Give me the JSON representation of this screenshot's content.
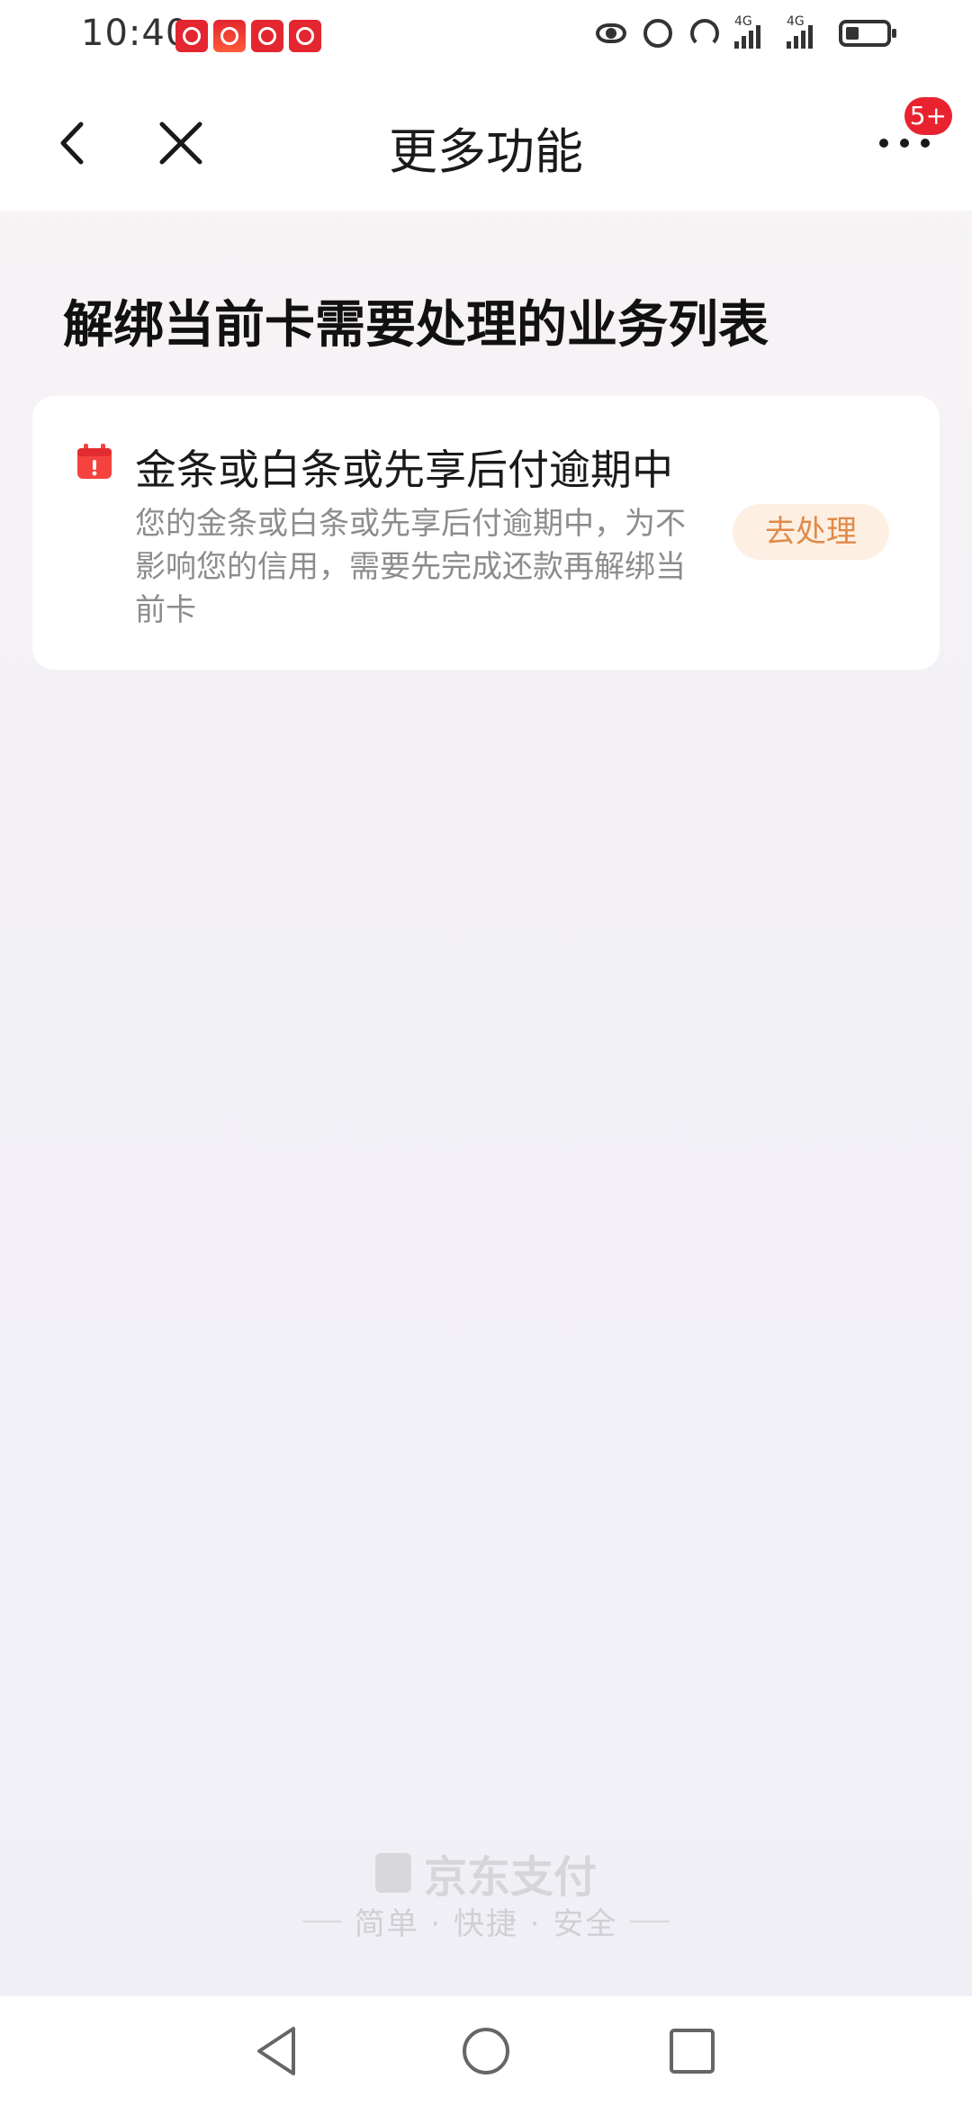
{
  "status_bar": {
    "time": "10:40",
    "signal_label_1": "4G",
    "signal_label_2": "4G"
  },
  "nav": {
    "title": "更多功能",
    "badge": "5+"
  },
  "section": {
    "heading": "解绑当前卡需要处理的业务列表"
  },
  "items": [
    {
      "title": "金条或白条或先享后付逾期中",
      "description": "您的金条或白条或先享后付逾期中，为不影响您的信用，需要先完成还款再解绑当前卡",
      "action_label": "去处理",
      "icon": "calendar-alert-icon"
    }
  ],
  "footer": {
    "brand": "京东支付",
    "slogan": "简单 · 快捷 · 安全"
  },
  "colors": {
    "accent_red": "#e8232f",
    "action_text": "#e08a4a",
    "action_bg": "#fdf0e3"
  }
}
